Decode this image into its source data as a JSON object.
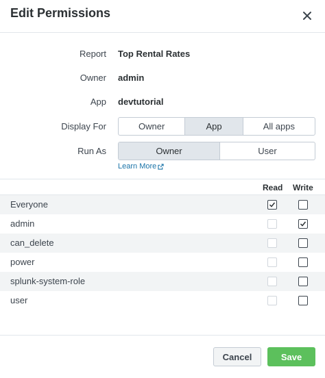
{
  "dialog": {
    "title": "Edit Permissions"
  },
  "fields": {
    "report": {
      "label": "Report",
      "value": "Top Rental Rates"
    },
    "owner": {
      "label": "Owner",
      "value": "admin"
    },
    "app": {
      "label": "App",
      "value": "devtutorial"
    },
    "display_for": {
      "label": "Display For",
      "options": [
        "Owner",
        "App",
        "All apps"
      ],
      "selected": "App"
    },
    "run_as": {
      "label": "Run As",
      "options": [
        "Owner",
        "User"
      ],
      "selected": "Owner"
    },
    "learn_more": "Learn More"
  },
  "permissions": {
    "headers": {
      "read": "Read",
      "write": "Write"
    },
    "rows": [
      {
        "role": "Everyone",
        "read": true,
        "read_enabled": true,
        "write": false
      },
      {
        "role": "admin",
        "read": false,
        "read_enabled": false,
        "write": true
      },
      {
        "role": "can_delete",
        "read": false,
        "read_enabled": false,
        "write": false
      },
      {
        "role": "power",
        "read": false,
        "read_enabled": false,
        "write": false
      },
      {
        "role": "splunk-system-role",
        "read": false,
        "read_enabled": false,
        "write": false
      },
      {
        "role": "user",
        "read": false,
        "read_enabled": false,
        "write": false
      }
    ]
  },
  "footer": {
    "cancel_label": "Cancel",
    "save_label": "Save"
  },
  "colors": {
    "save": "#5cc05c",
    "link": "#1a73a8",
    "active_segment": "#e1e6eb"
  }
}
